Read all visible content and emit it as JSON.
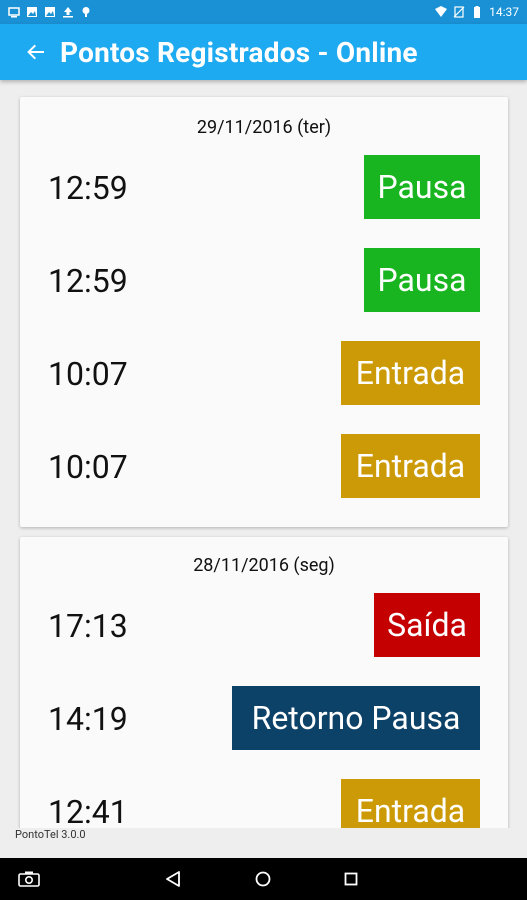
{
  "status_bar": {
    "time": "14:37"
  },
  "app_bar": {
    "title": "Pontos Registrados - Online"
  },
  "colors": {
    "pausa": "#18b520",
    "entrada": "#cc9a07",
    "saida": "#c40000",
    "retorno_pausa": "#0d4268"
  },
  "days": [
    {
      "date": "29/11/2016 (ter)",
      "entries": [
        {
          "time": "12:59",
          "type": "Pausa",
          "color": "#18b520"
        },
        {
          "time": "12:59",
          "type": "Pausa",
          "color": "#18b520"
        },
        {
          "time": "10:07",
          "type": "Entrada",
          "color": "#cc9a07"
        },
        {
          "time": "10:07",
          "type": "Entrada",
          "color": "#cc9a07"
        }
      ]
    },
    {
      "date": "28/11/2016 (seg)",
      "entries": [
        {
          "time": "17:13",
          "type": "Saída",
          "color": "#c40000"
        },
        {
          "time": "14:19",
          "type": "Retorno Pausa",
          "color": "#0d4268"
        },
        {
          "time": "12:41",
          "type": "Entrada",
          "color": "#cc9a07"
        }
      ]
    }
  ],
  "footer": {
    "version": "PontoTel 3.0.0"
  }
}
